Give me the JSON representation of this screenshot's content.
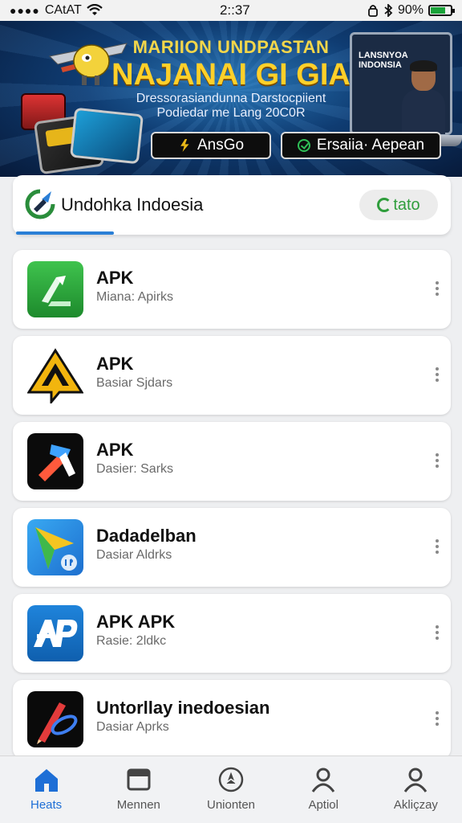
{
  "status_bar": {
    "carrier": "CAtAT",
    "time": "2::37",
    "battery": "90%",
    "battery_level": 0.7
  },
  "banner": {
    "title_line1": "MARIION UNDPASTAN",
    "title_line2": "NAJANAI GI GIA",
    "subtitle_line1": "Dressorasiandunna Darstocpiient",
    "subtitle_line2": "Podiedar me Lang 20C0R",
    "laptop_text": "LANSNYOA INDONSIA",
    "buttons": [
      {
        "label": "AnsGo",
        "icon": "bolt-icon"
      },
      {
        "label": "Ersaiia· Aepean",
        "icon": "check-circle-icon"
      }
    ]
  },
  "header": {
    "title": "Undohka Indoesia",
    "chip_label": "tato",
    "accent": "#2a7fd6",
    "chip_color": "#2f9d3c"
  },
  "apps": [
    {
      "title": "APK",
      "subtitle": "Miana: Apirks",
      "icon": "green-arrow-icon"
    },
    {
      "title": "APK",
      "subtitle": "Basiar Sjdars",
      "icon": "yellow-a-icon"
    },
    {
      "title": "APK",
      "subtitle": "Dasier: Sarks",
      "icon": "blue-hammer-icon"
    },
    {
      "title": "Dadadelban",
      "subtitle": "Dasiar Aldrks",
      "icon": "kite-icon"
    },
    {
      "title": "APK APK",
      "subtitle": "Rasie: 2ldkc",
      "icon": "ap-logo-icon"
    },
    {
      "title": "Untorllay inedoesian",
      "subtitle": "Dasiar Aprks",
      "icon": "pen-icon"
    }
  ],
  "bottom_nav": [
    {
      "label": "Heats",
      "icon": "home-icon",
      "active": true
    },
    {
      "label": "Mennen",
      "icon": "window-icon",
      "active": false
    },
    {
      "label": "Unionten",
      "icon": "compass-icon",
      "active": false
    },
    {
      "label": "Aptiol",
      "icon": "user-icon",
      "active": false
    },
    {
      "label": "Akliçzay",
      "icon": "user-icon",
      "active": false
    }
  ]
}
